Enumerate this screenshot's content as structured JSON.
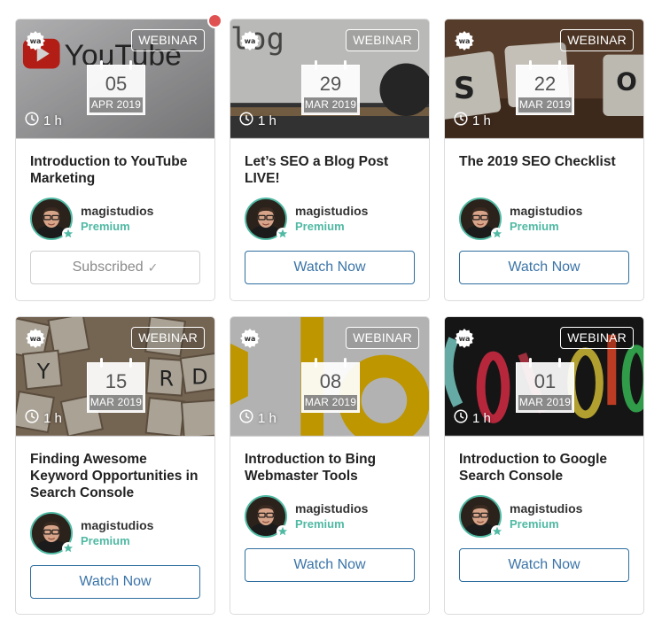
{
  "cards": [
    {
      "badge": "WEBINAR",
      "day": "05",
      "month": "APR 2019",
      "duration": "1 h",
      "title": "Introduction to YouTube Marketing",
      "author": "magistudios",
      "tier": "Premium",
      "button": "Subscribed",
      "button_state": "subscribed",
      "thumb": "youtube"
    },
    {
      "badge": "WEBINAR",
      "day": "29",
      "month": "MAR 2019",
      "duration": "1 h",
      "title": "Let’s SEO a Blog Post LIVE!",
      "author": "magistudios",
      "tier": "Premium",
      "button": "Watch Now",
      "button_state": "watch",
      "thumb": "blog"
    },
    {
      "badge": "WEBINAR",
      "day": "22",
      "month": "MAR 2019",
      "duration": "1 h",
      "title": "The 2019 SEO Checklist",
      "author": "magistudios",
      "tier": "Premium",
      "button": "Watch Now",
      "button_state": "watch",
      "thumb": "seo"
    },
    {
      "badge": "WEBINAR",
      "day": "15",
      "month": "MAR 2019",
      "duration": "1 h",
      "title": "Finding Awesome Keyword Opportunities in Search Console",
      "author": "magistudios",
      "tier": "Premium",
      "button": "Watch Now",
      "button_state": "watch",
      "thumb": "keyword"
    },
    {
      "badge": "WEBINAR",
      "day": "08",
      "month": "MAR 2019",
      "duration": "1 h",
      "title": "Introduction to Bing Webmaster Tools",
      "author": "magistudios",
      "tier": "Premium",
      "button": "Watch Now",
      "button_state": "watch",
      "thumb": "bing"
    },
    {
      "badge": "WEBINAR",
      "day": "01",
      "month": "MAR 2019",
      "duration": "1 h",
      "title": "Introduction to Google Search Console",
      "author": "magistudios",
      "tier": "Premium",
      "button": "Watch Now",
      "button_state": "watch",
      "thumb": "google"
    }
  ],
  "colors": {
    "accent": "#4fb9a3",
    "button_blue": "#3b74a8",
    "notification": "#e05252"
  },
  "icons": {
    "logo": "wa-logo-icon",
    "clock": "clock-icon",
    "check": "check-icon",
    "star": "star-icon"
  }
}
